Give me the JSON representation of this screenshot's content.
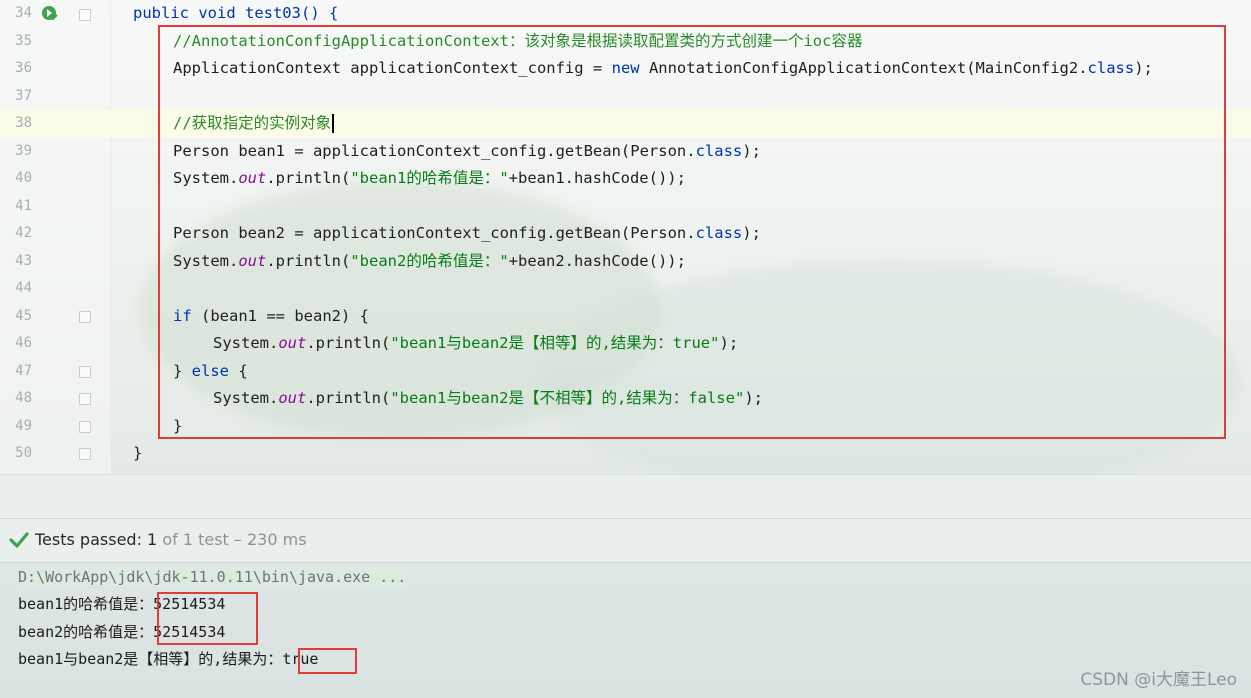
{
  "editor": {
    "lines": [
      {
        "n": "34",
        "tokens": [
          {
            "t": "public void ",
            "c": "kw"
          },
          {
            "t": "test03",
            "c": "kw"
          },
          {
            "t": "() {",
            "c": "kw"
          }
        ],
        "indent": 133
      },
      {
        "n": "35",
        "tokens": [
          {
            "t": "//AnnotationConfigApplicationContext：该对象是根据读取配置类的方式创建一个ioc容器",
            "c": "cm"
          }
        ],
        "indent": 173
      },
      {
        "n": "36",
        "tokens": [
          {
            "t": "ApplicationContext applicationContext_config = ",
            "c": ""
          },
          {
            "t": "new ",
            "c": "kw"
          },
          {
            "t": "AnnotationConfigApplicationContext(MainConfig2.",
            "c": ""
          },
          {
            "t": "class",
            "c": "kw"
          },
          {
            "t": ");",
            "c": ""
          }
        ],
        "indent": 173
      },
      {
        "n": "37",
        "tokens": [],
        "indent": 173
      },
      {
        "n": "38",
        "tokens": [
          {
            "t": "//获取指定的实例对象",
            "c": "cm"
          }
        ],
        "indent": 173,
        "current": true
      },
      {
        "n": "39",
        "tokens": [
          {
            "t": "Person bean1 = applicationContext_config.getBean(Person.",
            "c": ""
          },
          {
            "t": "class",
            "c": "kw"
          },
          {
            "t": ");",
            "c": ""
          }
        ],
        "indent": 173
      },
      {
        "n": "40",
        "tokens": [
          {
            "t": "System.",
            "c": ""
          },
          {
            "t": "out",
            "c": "fld"
          },
          {
            "t": ".println(",
            "c": ""
          },
          {
            "t": "\"bean1的哈希值是：\"",
            "c": "st"
          },
          {
            "t": "+bean1.hashCode());",
            "c": ""
          }
        ],
        "indent": 173
      },
      {
        "n": "41",
        "tokens": [],
        "indent": 173
      },
      {
        "n": "42",
        "tokens": [
          {
            "t": "Person bean2 = applicationContext_config.getBean(Person.",
            "c": ""
          },
          {
            "t": "class",
            "c": "kw"
          },
          {
            "t": ");",
            "c": ""
          }
        ],
        "indent": 173
      },
      {
        "n": "43",
        "tokens": [
          {
            "t": "System.",
            "c": ""
          },
          {
            "t": "out",
            "c": "fld"
          },
          {
            "t": ".println(",
            "c": ""
          },
          {
            "t": "\"bean2的哈希值是：\"",
            "c": "st"
          },
          {
            "t": "+bean2.hashCode());",
            "c": ""
          }
        ],
        "indent": 173
      },
      {
        "n": "44",
        "tokens": [],
        "indent": 173
      },
      {
        "n": "45",
        "tokens": [
          {
            "t": "if ",
            "c": "kw"
          },
          {
            "t": "(bean1 == bean2) {",
            "c": ""
          }
        ],
        "indent": 173
      },
      {
        "n": "46",
        "tokens": [
          {
            "t": "System.",
            "c": ""
          },
          {
            "t": "out",
            "c": "fld"
          },
          {
            "t": ".println(",
            "c": ""
          },
          {
            "t": "\"bean1与bean2是【相等】的,结果为：true\"",
            "c": "st"
          },
          {
            "t": ");",
            "c": ""
          }
        ],
        "indent": 213
      },
      {
        "n": "47",
        "tokens": [
          {
            "t": "} ",
            "c": ""
          },
          {
            "t": "else ",
            "c": "kw"
          },
          {
            "t": "{",
            "c": ""
          }
        ],
        "indent": 173
      },
      {
        "n": "48",
        "tokens": [
          {
            "t": "System.",
            "c": ""
          },
          {
            "t": "out",
            "c": "fld"
          },
          {
            "t": ".println(",
            "c": ""
          },
          {
            "t": "\"bean1与bean2是【不相等】的,结果为：false\"",
            "c": "st"
          },
          {
            "t": ");",
            "c": ""
          }
        ],
        "indent": 213
      },
      {
        "n": "49",
        "tokens": [
          {
            "t": "}",
            "c": ""
          }
        ],
        "indent": 173
      },
      {
        "n": "50",
        "tokens": [
          {
            "t": "}",
            "c": ""
          }
        ],
        "indent": 133
      }
    ]
  },
  "tests": {
    "label": "Tests passed: ",
    "count": "1",
    "detail": " of 1 test – 230 ms"
  },
  "console": {
    "command": "D:\\WorkApp\\jdk\\jdk-11.0.11\\bin\\java.exe ...",
    "line1_prefix": "bean1的哈希值是：",
    "line1_value": "52514534",
    "line2_prefix": "bean2的哈希值是：",
    "line2_value": "52514534",
    "line3_prefix": "bean1与bean2是【相等】的,结果为：",
    "line3_value": "true"
  },
  "watermark": "CSDN @i大魔王Leo",
  "colors": {
    "annotation_red": "#e23b3b",
    "keyword": "#0033b3",
    "comment": "#2a8a2a",
    "string": "#067d17",
    "pass_green": "#3ea34b"
  }
}
